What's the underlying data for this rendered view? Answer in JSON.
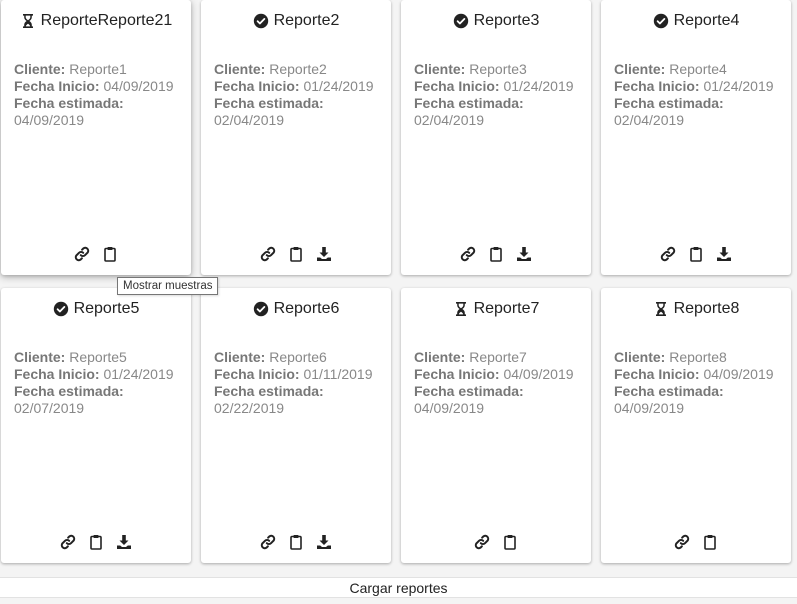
{
  "labels": {
    "cliente": "Cliente:",
    "fecha_inicio": "Fecha Inicio:",
    "fecha_estimada": "Fecha estimada:"
  },
  "reports": [
    {
      "title": "ReporteReporte21",
      "status": "hourglass-icon",
      "cliente": "Reporte1",
      "fecha_inicio": "04/09/2019",
      "fecha_estimada": "04/09/2019",
      "actions": [
        "link-icon",
        "clipboard-icon"
      ]
    },
    {
      "title": "Reporte2",
      "status": "check-circle-icon",
      "cliente": "Reporte2",
      "fecha_inicio": "01/24/2019",
      "fecha_estimada": "02/04/2019",
      "actions": [
        "link-icon",
        "clipboard-icon",
        "download-icon"
      ]
    },
    {
      "title": "Reporte3",
      "status": "check-circle-icon",
      "cliente": "Reporte3",
      "fecha_inicio": "01/24/2019",
      "fecha_estimada": "02/04/2019",
      "actions": [
        "link-icon",
        "clipboard-icon",
        "download-icon"
      ]
    },
    {
      "title": "Reporte4",
      "status": "check-circle-icon",
      "cliente": "Reporte4",
      "fecha_inicio": "01/24/2019",
      "fecha_estimada": "02/04/2019",
      "actions": [
        "link-icon",
        "clipboard-icon",
        "download-icon"
      ]
    },
    {
      "title": "Reporte5",
      "status": "check-circle-icon",
      "cliente": "Reporte5",
      "fecha_inicio": "01/24/2019",
      "fecha_estimada": "02/07/2019",
      "actions": [
        "link-icon",
        "clipboard-icon",
        "download-icon"
      ]
    },
    {
      "title": "Reporte6",
      "status": "check-circle-icon",
      "cliente": "Reporte6",
      "fecha_inicio": "01/11/2019",
      "fecha_estimada": "02/22/2019",
      "actions": [
        "link-icon",
        "clipboard-icon",
        "download-icon"
      ]
    },
    {
      "title": "Reporte7",
      "status": "hourglass-icon",
      "cliente": "Reporte7",
      "fecha_inicio": "04/09/2019",
      "fecha_estimada": "04/09/2019",
      "actions": [
        "link-icon",
        "clipboard-icon"
      ]
    },
    {
      "title": "Reporte8",
      "status": "hourglass-icon",
      "cliente": "Reporte8",
      "fecha_inicio": "04/09/2019",
      "fecha_estimada": "04/09/2019",
      "actions": [
        "link-icon",
        "clipboard-icon"
      ]
    }
  ],
  "tooltip": {
    "text": "Mostrar muestras"
  },
  "footer": {
    "load_label": "Cargar reportes"
  },
  "colors": {
    "icon": "#222222",
    "label": "#777777",
    "value": "#888888"
  }
}
